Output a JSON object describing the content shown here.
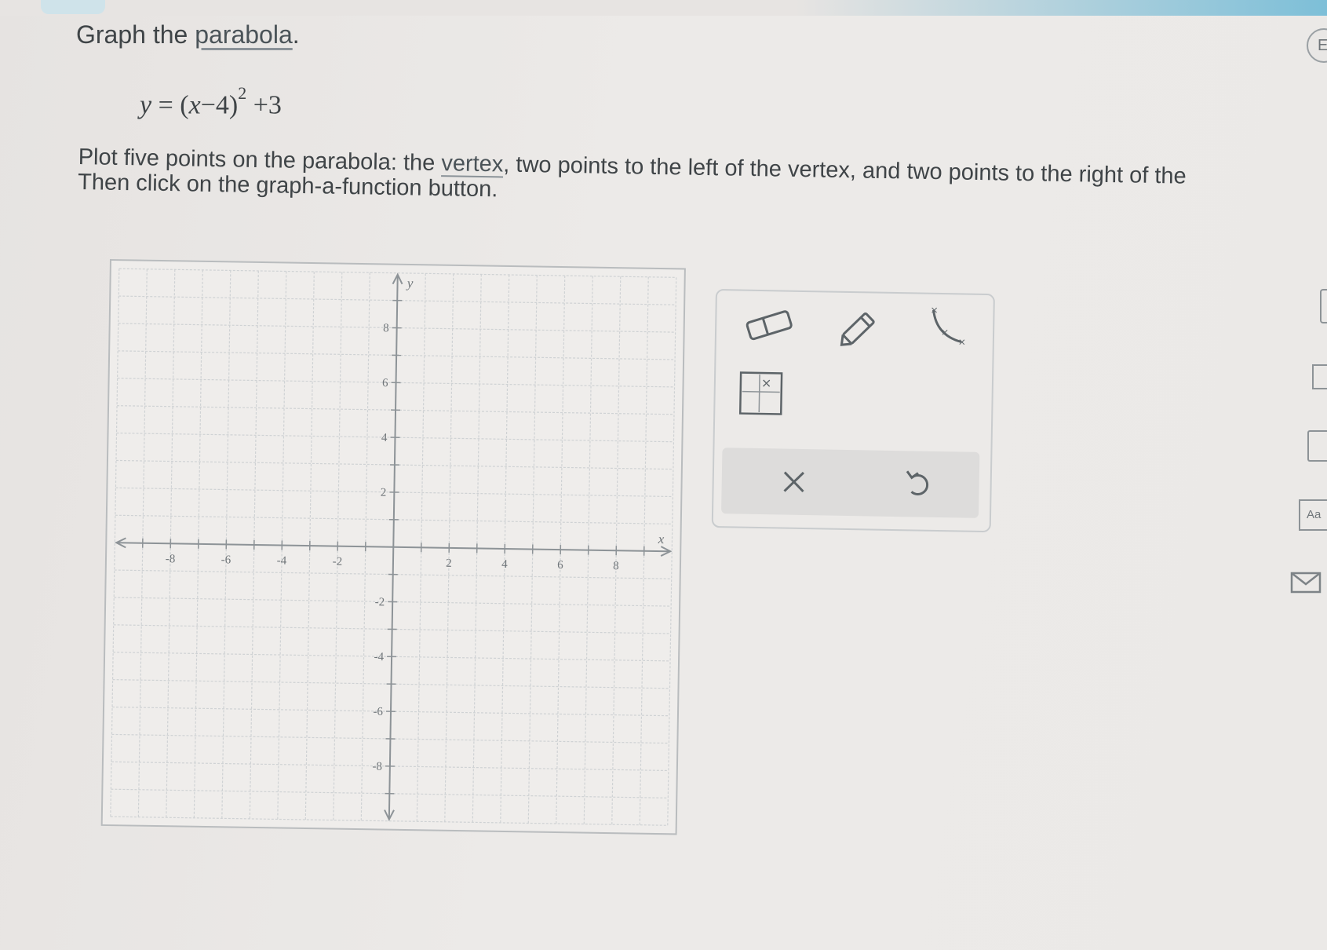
{
  "problem": {
    "title_prefix": "Graph the ",
    "title_link": "parabola",
    "title_suffix": ".",
    "equation": {
      "lhs": "y",
      "equals": "=",
      "paren_open": "(",
      "var": "x",
      "minus": "−",
      "h": "4",
      "paren_close": ")",
      "exponent": "2",
      "plus": "+",
      "k": "3"
    },
    "instructions_line1_a": "Plot five points on the parabola: the ",
    "instructions_link": "vertex",
    "instructions_line1_b": ", two points to the left of the vertex, and two points to the right of the",
    "instructions_line2": "Then click on the graph-a-function button."
  },
  "graph": {
    "x_axis_label": "x",
    "y_axis_label": "y",
    "x_range": [
      -10,
      10
    ],
    "y_range": [
      -10,
      10
    ],
    "x_tick_labels": [
      "-8",
      "-6",
      "-4",
      "-2",
      "2",
      "4",
      "6",
      "8"
    ],
    "y_tick_labels": [
      "8",
      "6",
      "4",
      "2",
      "-2",
      "-4",
      "-6",
      "-8"
    ],
    "grid": true
  },
  "tools": {
    "eraser_icon": "eraser-icon",
    "pencil_icon": "pencil-icon",
    "curve_icon": "graph-function-icon",
    "fx_icon": "function-grid-icon",
    "clear_icon": "close-icon",
    "undo_icon": "undo-icon"
  },
  "sidebar": {
    "top_button_label": "E",
    "glossary_label": "Aa"
  },
  "colors": {
    "page_bg": "#ebe9e7",
    "text": "#3f4447",
    "grid_line": "#cfd2d4",
    "axis": "#8d9397",
    "accent_top": "#7dbfd8"
  }
}
